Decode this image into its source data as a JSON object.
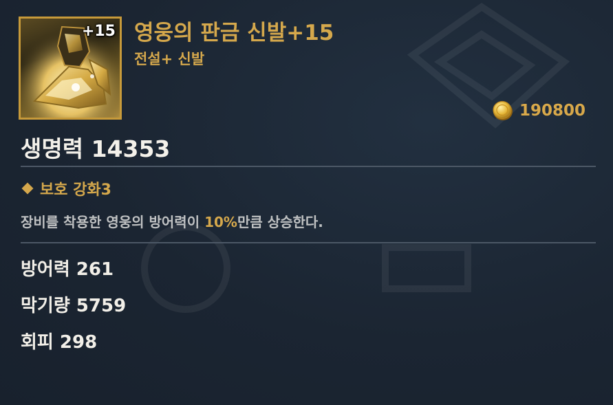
{
  "item": {
    "enhance_badge": "+15",
    "name": "영웅의 판금 신발+15",
    "subtitle": "전설+ 신발",
    "icon": "armored-boots-icon"
  },
  "price": {
    "icon": "gold-coin-icon",
    "value": "190800"
  },
  "main_stat": {
    "text": "생명력 14353"
  },
  "effect": {
    "title": "보호 강화3",
    "desc_before": "장비를 착용한 영웅의 방어력이 ",
    "desc_highlight": "10%",
    "desc_after": "만큼 상승한다."
  },
  "sub_stats": [
    {
      "text": "방어력 261"
    },
    {
      "text": "막기량 5759"
    },
    {
      "text": "회피 298"
    }
  ],
  "colors": {
    "gold": "#d5a84c",
    "background": "#1c2633",
    "text": "#f2efe8",
    "muted": "#c0c2c3"
  }
}
